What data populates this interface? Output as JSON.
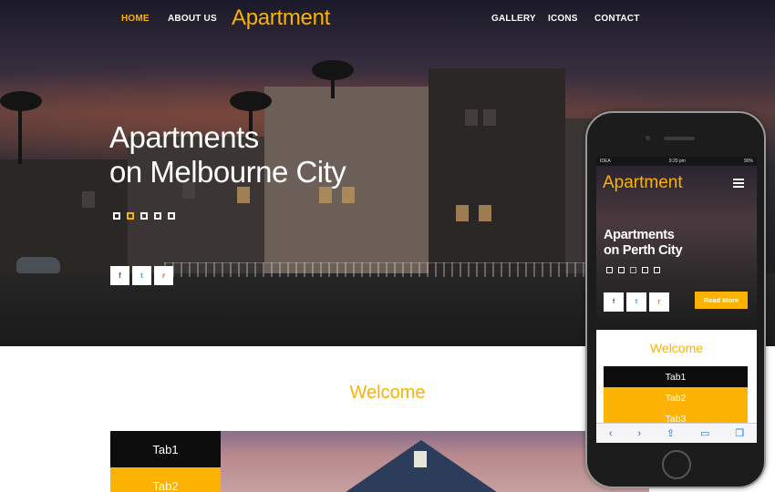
{
  "nav": {
    "home": "HOME",
    "about": "ABOUT US",
    "logo": "Apartment",
    "gallery": "GALLERY",
    "icons": "ICONS",
    "contact": "CONTACT"
  },
  "hero": {
    "title_line1": "Apartments",
    "title_line2": "on Melbourne City",
    "slide_count": 5,
    "active_slide": 2,
    "social": {
      "facebook": "f",
      "twitter": "t",
      "rss": "r"
    }
  },
  "welcome": {
    "heading": "Welcome",
    "tabs": [
      "Tab1",
      "Tab2"
    ]
  },
  "phone": {
    "status_left": "IDEA",
    "status_time": "9:20 pm",
    "status_battery": "90%",
    "logo": "Apartment",
    "title_line1": "Apartments",
    "title_line2": "on Perth City",
    "active_slide": 3,
    "social": {
      "facebook": "f",
      "twitter": "t",
      "rss": "r"
    },
    "read_more": "Read More",
    "welcome": "Welcome",
    "tabs": [
      "Tab1",
      "Tab2",
      "Tab3"
    ],
    "toolbar": {
      "back": "‹",
      "forward": "›",
      "share": "⇪",
      "bookmarks": "▭",
      "tabs": "❐"
    }
  },
  "colors": {
    "accent": "#fbb200",
    "dark": "#0d0d0d"
  }
}
